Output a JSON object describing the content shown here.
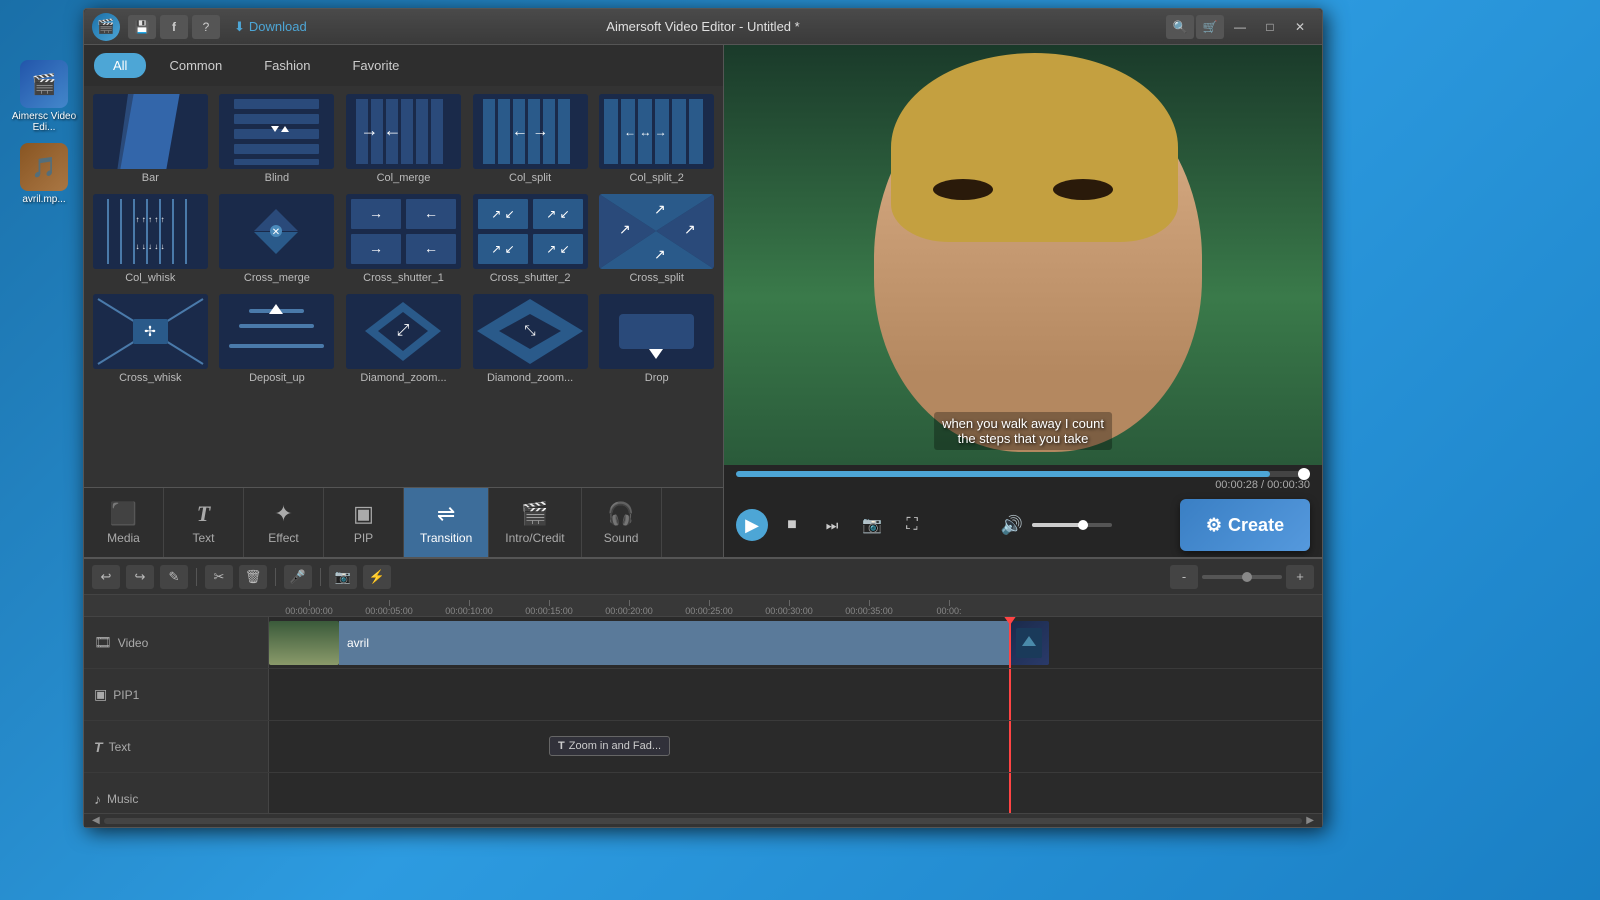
{
  "app": {
    "title": "Aimersoft Video Editor - Untitled *",
    "logo_icon": "🎬",
    "window_controls": {
      "minimize": "—",
      "maximize": "□",
      "close": "✕"
    }
  },
  "toolbar": {
    "save_icon": "💾",
    "facebook_icon": "f",
    "help_icon": "?",
    "download_label": "Download",
    "search_icon": "🔍",
    "cart_icon": "🛒"
  },
  "filter_tabs": {
    "items": [
      {
        "id": "all",
        "label": "All",
        "active": true
      },
      {
        "id": "common",
        "label": "Common",
        "active": false
      },
      {
        "id": "fashion",
        "label": "Fashion",
        "active": false
      },
      {
        "id": "favorite",
        "label": "Favorite",
        "active": false
      }
    ]
  },
  "transitions": [
    {
      "id": "bar",
      "label": "Bar",
      "pattern": "bar"
    },
    {
      "id": "blind",
      "label": "Blind",
      "pattern": "blind"
    },
    {
      "id": "col_merge",
      "label": "Col_merge",
      "pattern": "col_merge"
    },
    {
      "id": "col_split",
      "label": "Col_split",
      "pattern": "col_split"
    },
    {
      "id": "col_split_2",
      "label": "Col_split_2",
      "pattern": "col_split_2"
    },
    {
      "id": "col_whisk",
      "label": "Col_whisk",
      "pattern": "col_whisk"
    },
    {
      "id": "cross_merge",
      "label": "Cross_merge",
      "pattern": "cross_merge"
    },
    {
      "id": "cross_shutter_1",
      "label": "Cross_shutter_1",
      "pattern": "cross_shutter_1"
    },
    {
      "id": "cross_shutter_2",
      "label": "Cross_shutter_2",
      "pattern": "cross_shutter_2"
    },
    {
      "id": "cross_split",
      "label": "Cross_split",
      "pattern": "cross_split"
    },
    {
      "id": "cross_whisk",
      "label": "Cross_whisk",
      "pattern": "cross_whisk"
    },
    {
      "id": "deposit_up",
      "label": "Deposit_up",
      "pattern": "deposit_up"
    },
    {
      "id": "diamond_zoom_1",
      "label": "Diamond_zoom...",
      "pattern": "diamond_zoom_1"
    },
    {
      "id": "diamond_zoom_2",
      "label": "Diamond_zoom...",
      "pattern": "diamond_zoom_2"
    },
    {
      "id": "drop",
      "label": "Drop",
      "pattern": "drop"
    }
  ],
  "bottom_tabs": [
    {
      "id": "media",
      "label": "Media",
      "icon": "🎞",
      "active": false
    },
    {
      "id": "text",
      "label": "Text",
      "icon": "T",
      "active": false
    },
    {
      "id": "effect",
      "label": "Effect",
      "icon": "✨",
      "active": false
    },
    {
      "id": "pip",
      "label": "PIP",
      "icon": "▣",
      "active": false
    },
    {
      "id": "transition",
      "label": "Transition",
      "icon": "⇌",
      "active": true
    },
    {
      "id": "intro_credit",
      "label": "Intro/Credit",
      "icon": "🎬",
      "active": false
    },
    {
      "id": "sound",
      "label": "Sound",
      "icon": "🎧",
      "active": false
    }
  ],
  "preview": {
    "subtitle_line1": "when you walk away I count",
    "subtitle_line2": "the steps that you take"
  },
  "playback": {
    "time_current": "00:00:28",
    "time_total": "00:00:30",
    "time_display": "00:00:28 / 00:00:30",
    "progress_percent": 93
  },
  "timeline": {
    "tools": {
      "undo": "↩",
      "redo": "↪",
      "edit": "✎",
      "cut": "✂",
      "delete": "🗑",
      "record": "🎤",
      "snapshot": "📷"
    },
    "time_markers": [
      "00:00:00:00",
      "00:00:05:00",
      "00:00:10:00",
      "00:00:15:00",
      "00:00:20:00",
      "00:00:25:00",
      "00:00:30:00",
      "00:00:35:00",
      "00:00:"
    ],
    "tracks": [
      {
        "id": "video",
        "label": "Video",
        "icon": "🎞",
        "has_clip": true,
        "clip_name": "avril"
      },
      {
        "id": "pip1",
        "label": "PIP1",
        "icon": "▣",
        "has_clip": false
      },
      {
        "id": "text",
        "label": "Text",
        "icon": "T",
        "has_clip": false,
        "tooltip": "Zoom in and Fad..."
      },
      {
        "id": "music",
        "label": "Music",
        "icon": "♪",
        "has_clip": false
      }
    ]
  },
  "create_button": {
    "label": "Create",
    "icon": "⚙"
  },
  "desktop": {
    "icons": [
      {
        "label": "Aimersc Video Edi...",
        "icon": "🎬"
      },
      {
        "label": "avril.mp...",
        "icon": "🎵"
      }
    ]
  }
}
